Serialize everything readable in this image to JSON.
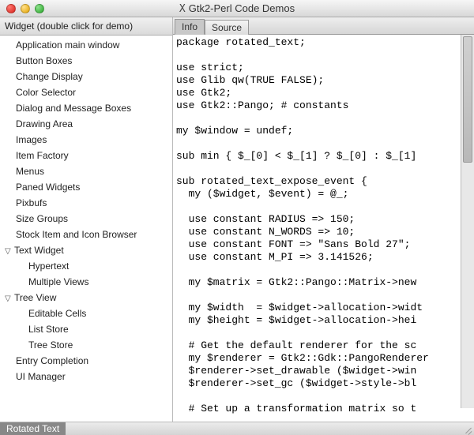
{
  "window": {
    "title": "Gtk2-Perl Code Demos"
  },
  "sidebar": {
    "header": "Widget (double click for demo)",
    "items": [
      {
        "label": "Application main window",
        "level": 0
      },
      {
        "label": "Button Boxes",
        "level": 0
      },
      {
        "label": "Change Display",
        "level": 0
      },
      {
        "label": "Color Selector",
        "level": 0
      },
      {
        "label": "Dialog and Message Boxes",
        "level": 0
      },
      {
        "label": "Drawing Area",
        "level": 0
      },
      {
        "label": "Images",
        "level": 0
      },
      {
        "label": "Item Factory",
        "level": 0
      },
      {
        "label": "Menus",
        "level": 0
      },
      {
        "label": "Paned Widgets",
        "level": 0
      },
      {
        "label": "Pixbufs",
        "level": 0
      },
      {
        "label": "Size Groups",
        "level": 0
      },
      {
        "label": "Stock Item and Icon Browser",
        "level": 0
      },
      {
        "label": "Text Widget",
        "level": 0,
        "expanded": true
      },
      {
        "label": "Hypertext",
        "level": 1
      },
      {
        "label": "Multiple Views",
        "level": 1
      },
      {
        "label": "Tree View",
        "level": 0,
        "expanded": true
      },
      {
        "label": "Editable Cells",
        "level": 1
      },
      {
        "label": "List Store",
        "level": 1
      },
      {
        "label": "Tree Store",
        "level": 1
      },
      {
        "label": "Entry Completion",
        "level": 0
      },
      {
        "label": "UI Manager",
        "level": 0
      }
    ]
  },
  "tabs": {
    "info": "Info",
    "source": "Source"
  },
  "code": "package rotated_text;\n\nuse strict;\nuse Glib qw(TRUE FALSE);\nuse Gtk2;\nuse Gtk2::Pango; # constants\n\nmy $window = undef;\n\nsub min { $_[0] < $_[1] ? $_[0] : $_[1]\n\nsub rotated_text_expose_event {\n  my ($widget, $event) = @_;\n\n  use constant RADIUS => 150;\n  use constant N_WORDS => 10;\n  use constant FONT => \"Sans Bold 27\";\n  use constant M_PI => 3.141526;\n\n  my $matrix = Gtk2::Pango::Matrix->new\n\n  my $width  = $widget->allocation->widt\n  my $height = $widget->allocation->hei\n\n  # Get the default renderer for the sc\n  my $renderer = Gtk2::Gdk::PangoRenderer\n  $renderer->set_drawable ($widget->win\n  $renderer->set_gc ($widget->style->bl\n\n  # Set up a transformation matrix so t",
  "status": {
    "label": "Rotated Text"
  }
}
